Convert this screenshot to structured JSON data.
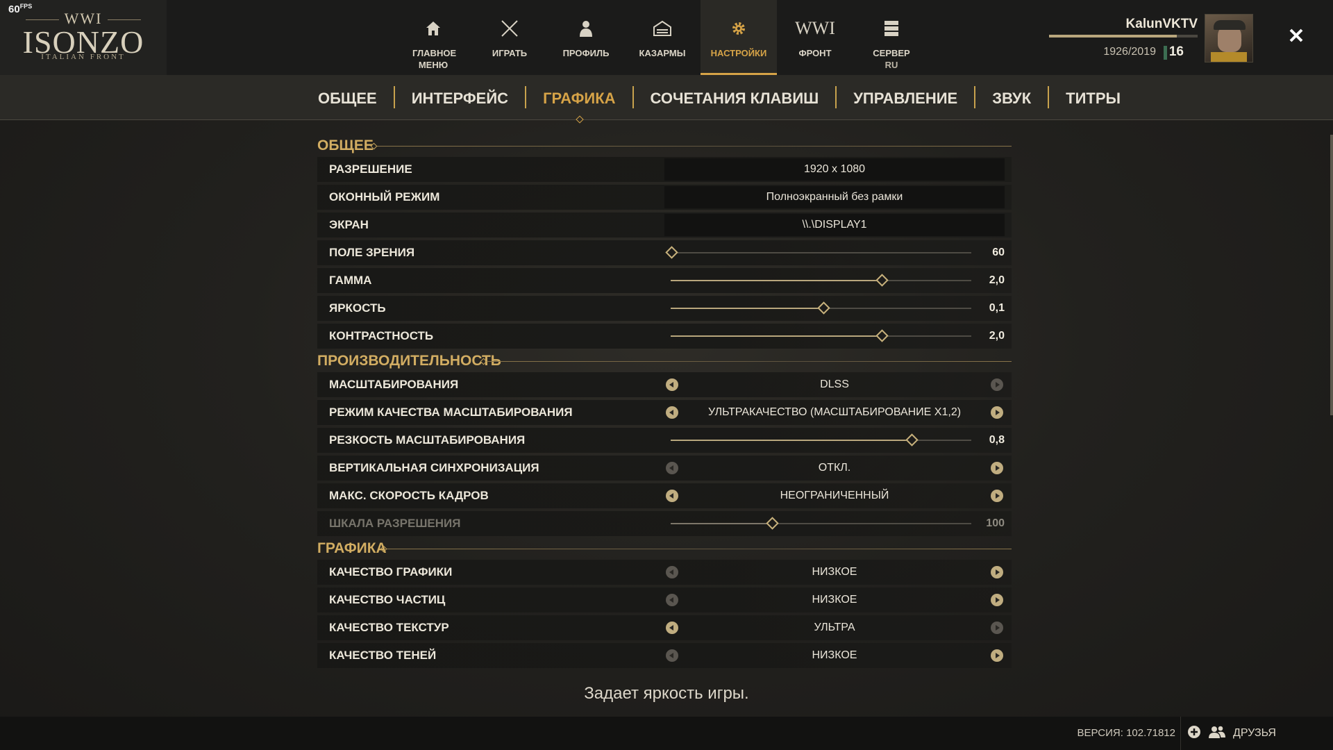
{
  "fps": {
    "value": "60",
    "unit": "FPS"
  },
  "logo": {
    "top": "WWI",
    "main": "ISONZO",
    "sub": "ITALIAN FRONT"
  },
  "nav": [
    {
      "label": "ГЛАВНОЕ МЕНЮ",
      "icon": "home-icon"
    },
    {
      "label": "ИГРАТЬ",
      "icon": "crossed-swords-icon"
    },
    {
      "label": "ПРОФИЛЬ",
      "icon": "profile-icon"
    },
    {
      "label": "КАЗАРМЫ",
      "icon": "barracks-icon"
    },
    {
      "label": "НАСТРОЙКИ",
      "icon": "gear-icon",
      "active": true
    },
    {
      "label": "ФРОНТ",
      "icon_text": "WWI"
    },
    {
      "label": "СЕРВЕР",
      "sub": "RU",
      "icon": "server-icon"
    }
  ],
  "user": {
    "name": "KalunVKTV",
    "xp": "1926/2019",
    "level": "16",
    "xp_progress": 0.86
  },
  "tabs": [
    {
      "label": "ОБЩЕЕ"
    },
    {
      "label": "ИНТЕРФЕЙС"
    },
    {
      "label": "ГРАФИКА",
      "active": true
    },
    {
      "label": "СОЧЕТАНИЯ КЛАВИШ"
    },
    {
      "label": "УПРАВЛЕНИЕ"
    },
    {
      "label": "ЗВУК"
    },
    {
      "label": "ТИТРЫ"
    }
  ],
  "sections": {
    "general": {
      "title": "ОБЩЕЕ",
      "resolution": {
        "label": "РАЗРЕШЕНИЕ",
        "value": "1920 x 1080"
      },
      "window_mode": {
        "label": "ОКОННЫЙ РЕЖИМ",
        "value": "Полноэкранный без рамки"
      },
      "screen": {
        "label": "ЭКРАН",
        "value": "\\\\.\\DISPLAY1"
      },
      "fov": {
        "label": "ПОЛЕ ЗРЕНИЯ",
        "value": "60",
        "fraction": 0.0
      },
      "gamma": {
        "label": "ГАММА",
        "value": "2,0",
        "fraction": 0.7
      },
      "brightness": {
        "label": "ЯРКОСТЬ",
        "value": "0,1",
        "fraction": 0.505
      },
      "contrast": {
        "label": "КОНТРАСТНОСТЬ",
        "value": "2,0",
        "fraction": 0.7
      }
    },
    "performance": {
      "title": "ПРОИЗВОДИТЕЛЬНОСТЬ",
      "upscaling": {
        "label": "МАСШТАБИРОВАНИЯ",
        "value": "DLSS",
        "left_enabled": true,
        "right_enabled": false
      },
      "upscaling_quality": {
        "label": "РЕЖИМ КАЧЕСТВА МАСШТАБИРОВАНИЯ",
        "value": "УЛЬТРАКАЧЕСТВО (МАСШТАБИРОВАНИЕ X1,2)",
        "left_enabled": true,
        "right_enabled": true
      },
      "upscaling_sharpness": {
        "label": "РЕЗКОСТЬ МАСШТАБИРОВАНИЯ",
        "value": "0,8",
        "fraction": 0.8
      },
      "vsync": {
        "label": "ВЕРТИКАЛЬНАЯ СИНХРОНИЗАЦИЯ",
        "value": "ОТКЛ.",
        "left_enabled": false,
        "right_enabled": true
      },
      "max_fps": {
        "label": "МАКС. СКОРОСТЬ КАДРОВ",
        "value": "НЕОГРАНИЧЕННЫЙ",
        "left_enabled": true,
        "right_enabled": true
      },
      "resolution_scale": {
        "label": "ШКАЛА РАЗРЕШЕНИЯ",
        "value": "100",
        "fraction": 0.335,
        "disabled": true
      }
    },
    "graphics": {
      "title": "ГРАФИКА",
      "graphics_quality": {
        "label": "КАЧЕСТВО ГРАФИКИ",
        "value": "НИЗКОЕ",
        "left_enabled": false,
        "right_enabled": true
      },
      "particle_quality": {
        "label": "КАЧЕСТВО ЧАСТИЦ",
        "value": "НИЗКОЕ",
        "left_enabled": false,
        "right_enabled": true
      },
      "texture_quality": {
        "label": "КАЧЕСТВО ТЕКСТУР",
        "value": "УЛЬТРА",
        "left_enabled": true,
        "right_enabled": false
      },
      "shadow_quality": {
        "label": "КАЧЕСТВО ТЕНЕЙ",
        "value": "НИЗКОЕ",
        "left_enabled": false,
        "right_enabled": true
      }
    }
  },
  "description": "Задает яркость игры.",
  "footer": {
    "version": "ВЕРСИЯ: 102.71812",
    "friends_label": "ДРУЗЬЯ"
  }
}
